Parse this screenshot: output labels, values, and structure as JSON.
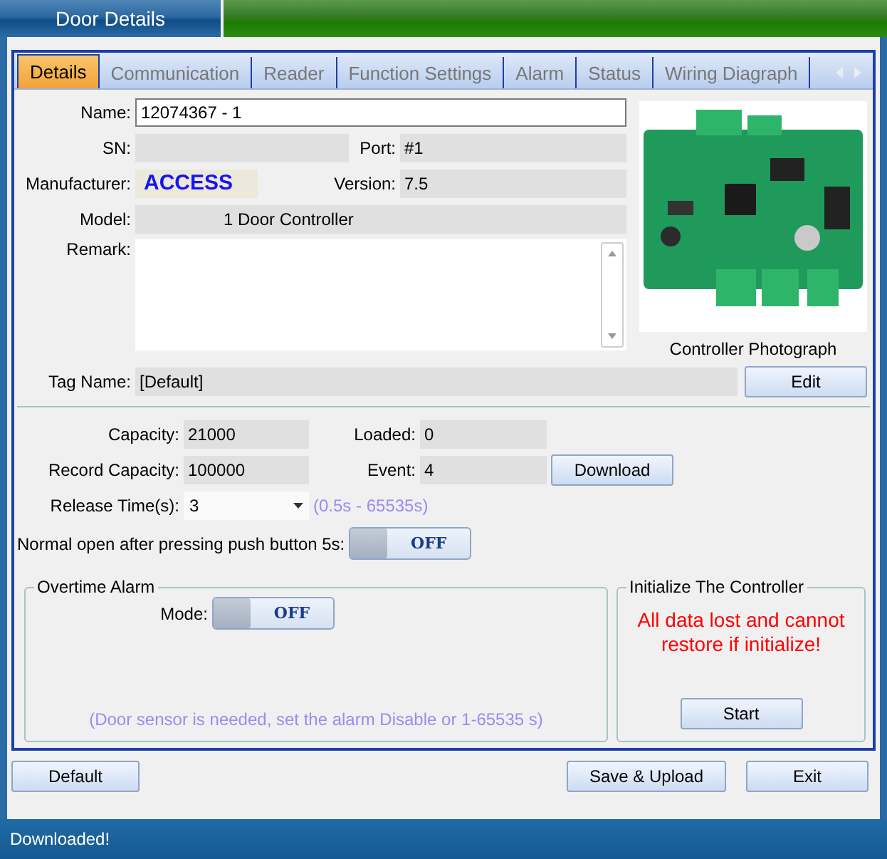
{
  "window": {
    "title": "Door Details"
  },
  "tabs": [
    {
      "label": "Details",
      "selected": true
    },
    {
      "label": "Communication",
      "selected": false
    },
    {
      "label": "Reader",
      "selected": false
    },
    {
      "label": "Function Settings",
      "selected": false
    },
    {
      "label": "Alarm",
      "selected": false
    },
    {
      "label": "Status",
      "selected": false
    },
    {
      "label": "Wiring Diagraph",
      "selected": false
    }
  ],
  "details": {
    "name": {
      "label": "Name:",
      "value": "12074367 - 1"
    },
    "sn": {
      "label": "SN:"
    },
    "port": {
      "label": "Port:",
      "value": "#1"
    },
    "manufacturer": {
      "label": "Manufacturer:",
      "value": "ACCESS"
    },
    "version": {
      "label": "Version:",
      "value": "7.5"
    },
    "model": {
      "label": "Model:",
      "value": "1 Door Controller"
    },
    "remark": {
      "label": "Remark:"
    },
    "photo_caption": "Controller Photograph",
    "tag_name": {
      "label": "Tag Name:",
      "value": "[Default]"
    },
    "edit_button": "Edit"
  },
  "records": {
    "capacity": {
      "label": "Capacity:",
      "value": "21000"
    },
    "loaded": {
      "label": "Loaded:",
      "value": "0"
    },
    "record_capacity": {
      "label": "Record Capacity:",
      "value": "100000"
    },
    "event": {
      "label": "Event:",
      "value": "4"
    },
    "download_button": "Download",
    "release_time": {
      "label": "Release Time(s):",
      "value": "3",
      "hint": "(0.5s - 65535s)"
    },
    "normal_open": {
      "label": "Normal open after pressing push button 5s:",
      "toggle_text": "OFF",
      "on": false
    }
  },
  "overtime_alarm": {
    "title": "Overtime Alarm",
    "mode_label": "Mode:",
    "toggle_text": "OFF",
    "on": false,
    "note": "(Door sensor is needed, set the alarm Disable or 1-65535 s)"
  },
  "initialize": {
    "title": "Initialize The Controller",
    "warning": "All data lost and cannot restore if initialize!",
    "button": "Start"
  },
  "buttons": [
    {
      "kind": "default",
      "label": "Default"
    },
    {
      "kind": "save",
      "label": "Save & Upload"
    },
    {
      "kind": "exit",
      "label": "Exit"
    }
  ],
  "status_bar": "Downloaded!"
}
